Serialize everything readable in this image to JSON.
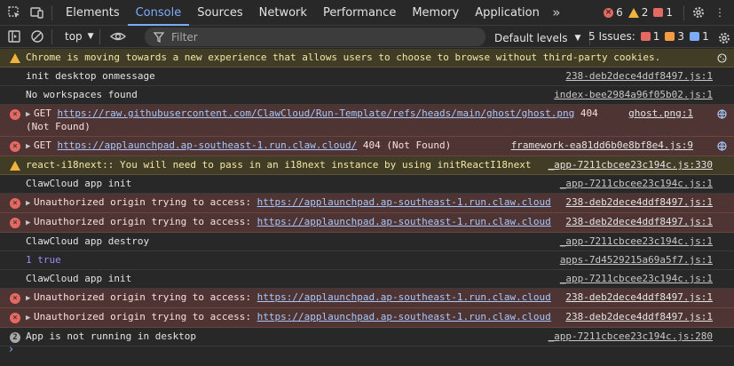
{
  "tabs": [
    "Elements",
    "Console",
    "Sources",
    "Network",
    "Performance",
    "Memory",
    "Application"
  ],
  "counts": {
    "errors": "6",
    "warnings": "2",
    "issues": "1"
  },
  "toolbar": {
    "context": "top",
    "filter_placeholder": "Filter",
    "levels": "Default levels",
    "issues_label": "5 Issues:",
    "issue_err": "1",
    "issue_warn": "3",
    "issue_info": "1"
  },
  "rows": [
    {
      "type": "warn",
      "text": "Chrome is moving towards a new experience that allows users to choose to browse without third-party cookies.",
      "src": ""
    },
    {
      "type": "log",
      "text": "init desktop onmessage",
      "src": "238-deb2dece4ddf8497.js:1"
    },
    {
      "type": "log",
      "text": "No workspaces found",
      "src": "index-bee2984a96f05b02.js:1"
    },
    {
      "type": "err",
      "pre": "GET ",
      "link": "https://raw.githubusercontent.com/ClawCloud/Run-Template/refs/heads/main/ghost/ghost.png",
      "post": " 404",
      "line2": "(Not Found)",
      "src": "ghost.png:1"
    },
    {
      "type": "err",
      "pre": "GET ",
      "link": "https://applaunchpad.ap-southeast-1.run.claw.cloud/",
      "post": " 404 (Not Found)",
      "src": "framework-ea81dd6b0e8bf8e4.js:9"
    },
    {
      "type": "warn",
      "text": "react-i18next:: You will need to pass in an i18next instance by using initReactI18next",
      "src": "_app-7211cbcee23c194c.js:330"
    },
    {
      "type": "log",
      "text": "ClawCloud app init",
      "src": "_app-7211cbcee23c194c.js:1"
    },
    {
      "type": "err",
      "pre": "Unauthorized origin trying to access: ",
      "link": "https://applaunchpad.ap-southeast-1.run.claw.cloud",
      "post": "",
      "src": "238-deb2dece4ddf8497.js:1"
    },
    {
      "type": "err",
      "pre": "Unauthorized origin trying to access: ",
      "link": "https://applaunchpad.ap-southeast-1.run.claw.cloud",
      "post": "",
      "src": "238-deb2dece4ddf8497.js:1"
    },
    {
      "type": "log",
      "text": "ClawCloud app destroy",
      "src": "_app-7211cbcee23c194c.js:1"
    },
    {
      "type": "num",
      "text": "1 true",
      "src": "apps-7d4529215a69a5f7.js:1"
    },
    {
      "type": "log",
      "text": "ClawCloud app init",
      "src": "_app-7211cbcee23c194c.js:1"
    },
    {
      "type": "err",
      "pre": "Unauthorized origin trying to access: ",
      "link": "https://applaunchpad.ap-southeast-1.run.claw.cloud",
      "post": "",
      "src": "238-deb2dece4ddf8497.js:1"
    },
    {
      "type": "err",
      "pre": "Unauthorized origin trying to access: ",
      "link": "https://applaunchpad.ap-southeast-1.run.claw.cloud",
      "post": "",
      "src": "238-deb2dece4ddf8497.js:1"
    },
    {
      "type": "rep",
      "count": "2",
      "text": "App is not running in desktop",
      "src": "_app-7211cbcee23c194c.js:280"
    }
  ],
  "prompt": "›"
}
